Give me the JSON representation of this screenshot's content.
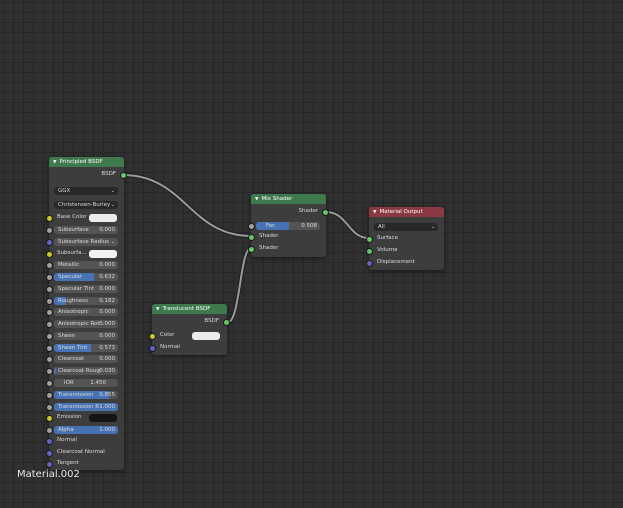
{
  "material_name": "Material.002",
  "principled": {
    "title": "Principled BSDF",
    "output": "BSDF",
    "distribution": "GGX",
    "subsurface_method": "Christensen-Burley",
    "params": {
      "base_color": "Base Color",
      "subsurface": {
        "label": "Subsurface",
        "value": "0.000"
      },
      "subsurface_radius": "Subsurface Radius",
      "subsurface_color": "Subsurfa...",
      "metallic": {
        "label": "Metallic",
        "value": "0.000"
      },
      "specular": {
        "label": "Specular",
        "value": "0.632",
        "fill": 0.632
      },
      "specular_tint": {
        "label": "Specular Tint",
        "value": "0.000"
      },
      "roughness": {
        "label": "Roughness",
        "value": "0.182",
        "fill": 0.182
      },
      "anisotropic": {
        "label": "Anisotropic",
        "value": "0.000"
      },
      "anisotropic_rot": {
        "label": "Anisotropic Rot",
        "value": "0.000"
      },
      "sheen": {
        "label": "Sheen",
        "value": "0.000"
      },
      "sheen_tint": {
        "label": "Sheen Tint",
        "value": "0.573",
        "fill": 0.573
      },
      "clearcoat": {
        "label": "Clearcoat",
        "value": "0.000"
      },
      "clearcoat_roughness": {
        "label": "Clearcoat Roug",
        "value": "0.030",
        "fill": 0.03
      },
      "ior": {
        "label": "IOR",
        "value": "1.450"
      },
      "transmission": {
        "label": "Transmission",
        "value": "0.855",
        "fill": 0.855
      },
      "transmission_roughness": {
        "label": "Transmission R",
        "value": "1.000",
        "fill": 1.0
      },
      "emission": "Emission",
      "alpha": {
        "label": "Alpha",
        "value": "1.000",
        "fill": 1.0
      },
      "normal": "Normal",
      "clearcoat_normal": "Clearcoat Normal",
      "tangent": "Tangent"
    }
  },
  "mix": {
    "title": "Mix Shader",
    "output": "Shader",
    "fac": {
      "label": "Fac",
      "value": "0.508",
      "fill": 0.508
    },
    "shader1": "Shader",
    "shader2": "Shader"
  },
  "output_node": {
    "title": "Material Output",
    "target": "All",
    "surface": "Surface",
    "volume": "Volume",
    "displacement": "Displacement"
  },
  "translucent": {
    "title": "Translucent BSDF",
    "output": "BSDF",
    "color": "Color",
    "normal": "Normal"
  },
  "colors": {
    "background": "#303030",
    "header_shader": "#3f7a4f",
    "header_output": "#8a3942",
    "value_fill": "#4772b3",
    "socket_shader": "#63c763",
    "socket_color": "#c7c729",
    "socket_float": "#a1a1a1",
    "socket_vector": "#6363c7",
    "wire": "#9a9a9a"
  }
}
